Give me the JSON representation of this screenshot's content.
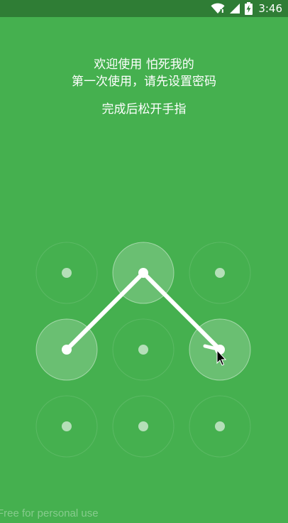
{
  "status_bar": {
    "time": "3:46",
    "icons": [
      "wifi-icon",
      "signal-icon",
      "battery-charging-icon"
    ]
  },
  "setup": {
    "welcome_line": "欢迎使用 怕死我的",
    "instruction_line": "第一次使用，请先设置密码",
    "hint": "完成后松开手指"
  },
  "pattern_lock": {
    "grid_size": 3,
    "dots": [
      {
        "row": 1,
        "col": 1,
        "selected": false
      },
      {
        "row": 1,
        "col": 2,
        "selected": true
      },
      {
        "row": 1,
        "col": 3,
        "selected": false
      },
      {
        "row": 2,
        "col": 1,
        "selected": true
      },
      {
        "row": 2,
        "col": 2,
        "selected": false
      },
      {
        "row": 2,
        "col": 3,
        "selected": true
      },
      {
        "row": 3,
        "col": 1,
        "selected": false
      },
      {
        "row": 3,
        "col": 2,
        "selected": false
      },
      {
        "row": 3,
        "col": 3,
        "selected": false
      }
    ],
    "pattern_sequence": [
      4,
      2,
      6
    ]
  },
  "watermark": "Free for personal use",
  "colors": {
    "background": "#45b04f",
    "status_bar": "#2f7d35",
    "text": "#ffffff"
  }
}
